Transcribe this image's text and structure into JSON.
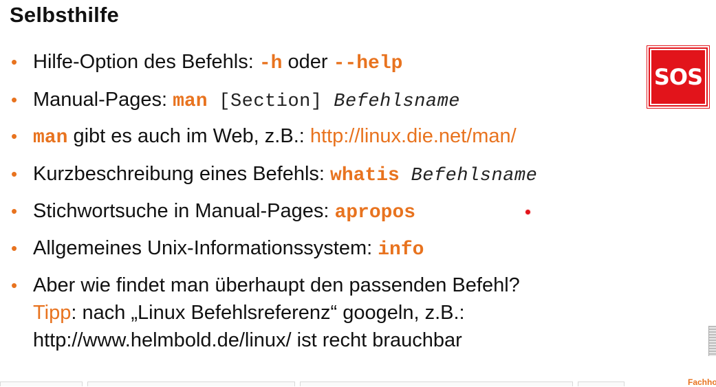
{
  "title": "Selbsthilfe",
  "bullets": {
    "b1": {
      "text": "Hilfe-Option des Befehls: ",
      "code1": "-h",
      "mid": " oder ",
      "code2": "--help"
    },
    "b2": {
      "text": "Manual-Pages: ",
      "code": "man",
      "arg1": " [Section] ",
      "arg2": "Befehlsname"
    },
    "b3": {
      "code": "man",
      "text": " gibt es auch im Web, z.B.: ",
      "link": "http://linux.die.net/man/"
    },
    "b4": {
      "text": "Kurzbeschreibung eines Befehls: ",
      "code": "whatis",
      "arg": " Befehlsname"
    },
    "b5": {
      "text": "Stichwortsuche in Manual-Pages: ",
      "code": "apropos"
    },
    "b6": {
      "text": "Allgemeines Unix-Informationssystem: ",
      "code": "info"
    },
    "b7": {
      "line1": "Aber wie findet man überhaupt den passenden Befehl?",
      "tipp": "Tipp",
      "line2": ": nach „Linux Befehlsreferenz“ googeln, z.B.:",
      "line3": "http://www.helmbold.de/linux/ ist recht brauchbar"
    }
  },
  "bullet_glyph": "•",
  "sos_label": "SOS",
  "footer_text": "Fachho",
  "colors": {
    "accent": "#e8731f",
    "sos_red": "#e2141b",
    "text": "#111111"
  }
}
